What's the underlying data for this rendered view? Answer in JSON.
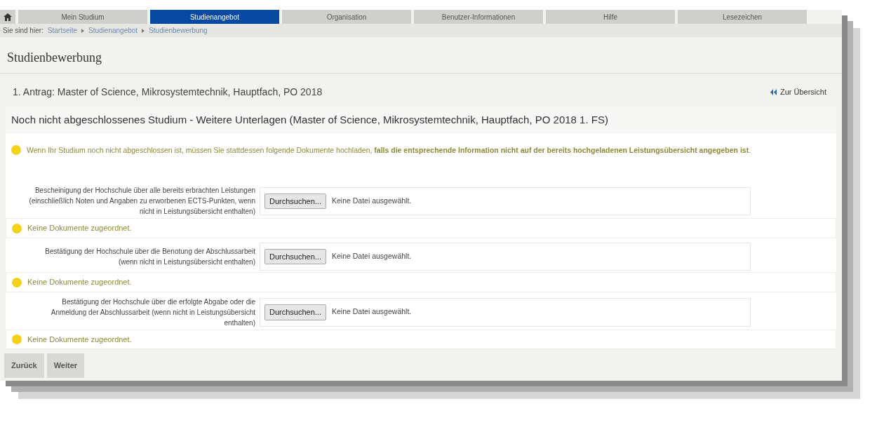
{
  "nav": {
    "tabs": [
      {
        "label": "Mein Studium",
        "selected": false
      },
      {
        "label": "Studienangebot",
        "selected": true
      },
      {
        "label": "Organisation",
        "selected": false
      },
      {
        "label": "Benutzer-Informationen",
        "selected": false
      },
      {
        "label": "Hilfe",
        "selected": false
      },
      {
        "label": "Lesezeichen",
        "selected": false
      }
    ]
  },
  "breadcrumb": {
    "label": "Sie sind hier:",
    "items": [
      "Startseite",
      "Studienangebot",
      "Studienbewerbung"
    ]
  },
  "page_title": "Studienbewerbung",
  "application": {
    "title": "1. Antrag: Master of Science, Mikrosystemtechnik, Hauptfach, PO 2018",
    "back_link": "Zur Übersicht"
  },
  "section": {
    "title": "Noch nicht abgeschlossenes Studium - Weitere Unterlagen (Master of Science, Mikrosystemtechnik, Hauptfach, PO 2018 1. FS)",
    "notice": "Wenn Ihr Studium noch nicht abgeschlossen ist, müssen Sie stattdessen folgende Dokumente hochladen, **falls die entsprechende Information nicht auf der bereits hochgeladenen Leistungsübersicht angegeben ist**.",
    "uploads": [
      {
        "label": "Bescheinigung der Hochschule über alle bereits erbrachten Leistungen (einschließlich Noten und Angaben zu erworbenen ECTS-Punkten, wenn nicht in Leistungsübersicht enthalten)",
        "button": "Durchsuchen...",
        "file_status": "Keine Datei ausgewählt.",
        "documents_status": "Keine Dokumente zugeordnet."
      },
      {
        "label": "Bestätigung der Hochschule über die Benotung der Abschlussarbeit (wenn nicht in Leistungsübersicht enthalten)",
        "button": "Durchsuchen...",
        "file_status": "Keine Datei ausgewählt.",
        "documents_status": "Keine Dokumente zugeordnet."
      },
      {
        "label": "Bestätigung der Hochschule über die erfolgte Abgabe oder die Anmeldung der Abschlussarbeit (wenn nicht in Leistungsübersicht enthalten)",
        "button": "Durchsuchen...",
        "file_status": "Keine Datei ausgewählt.",
        "documents_status": "Keine Dokumente zugeordnet."
      }
    ]
  },
  "buttons": [
    "Zurück",
    "Weiter"
  ]
}
